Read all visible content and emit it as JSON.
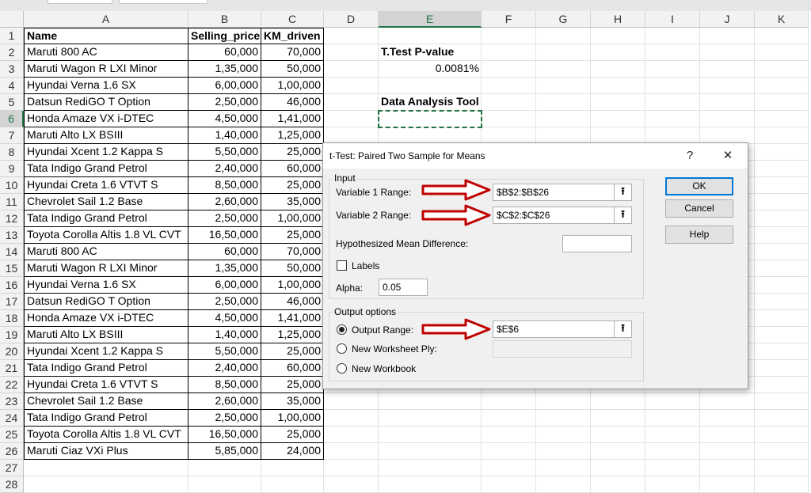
{
  "columns": [
    "A",
    "B",
    "C",
    "D",
    "E",
    "F",
    "G",
    "H",
    "I",
    "J",
    "K"
  ],
  "rows": [
    "1",
    "2",
    "3",
    "4",
    "5",
    "6",
    "7",
    "8",
    "9",
    "10",
    "11",
    "12",
    "13",
    "14",
    "15",
    "16",
    "17",
    "18",
    "19",
    "20",
    "21",
    "22",
    "23",
    "24",
    "25",
    "26",
    "27",
    "28"
  ],
  "table": {
    "headers": [
      "Name",
      "Selling_price",
      "KM_driven"
    ],
    "data": [
      [
        "Maruti 800 AC",
        "60,000",
        "70,000"
      ],
      [
        "Maruti Wagon R LXI Minor",
        "1,35,000",
        "50,000"
      ],
      [
        "Hyundai Verna 1.6 SX",
        "6,00,000",
        "1,00,000"
      ],
      [
        "Datsun RediGO T Option",
        "2,50,000",
        "46,000"
      ],
      [
        "Honda Amaze VX i-DTEC",
        "4,50,000",
        "1,41,000"
      ],
      [
        "Maruti Alto LX BSIII",
        "1,40,000",
        "1,25,000"
      ],
      [
        "Hyundai Xcent 1.2 Kappa S",
        "5,50,000",
        "25,000"
      ],
      [
        "Tata Indigo Grand Petrol",
        "2,40,000",
        "60,000"
      ],
      [
        "Hyundai Creta 1.6 VTVT S",
        "8,50,000",
        "25,000"
      ],
      [
        "Chevrolet Sail 1.2 Base",
        "2,60,000",
        "35,000"
      ],
      [
        "Tata Indigo Grand Petrol",
        "2,50,000",
        "1,00,000"
      ],
      [
        "Toyota Corolla Altis 1.8 VL CVT",
        "16,50,000",
        "25,000"
      ],
      [
        "Maruti 800 AC",
        "60,000",
        "70,000"
      ],
      [
        "Maruti Wagon R LXI Minor",
        "1,35,000",
        "50,000"
      ],
      [
        "Hyundai Verna 1.6 SX",
        "6,00,000",
        "1,00,000"
      ],
      [
        "Datsun RediGO T Option",
        "2,50,000",
        "46,000"
      ],
      [
        "Honda Amaze VX i-DTEC",
        "4,50,000",
        "1,41,000"
      ],
      [
        "Maruti Alto LX BSIII",
        "1,40,000",
        "1,25,000"
      ],
      [
        "Hyundai Xcent 1.2 Kappa S",
        "5,50,000",
        "25,000"
      ],
      [
        "Tata Indigo Grand Petrol",
        "2,40,000",
        "60,000"
      ],
      [
        "Hyundai Creta 1.6 VTVT S",
        "8,50,000",
        "25,000"
      ],
      [
        "Chevrolet Sail 1.2 Base",
        "2,60,000",
        "35,000"
      ],
      [
        "Tata Indigo Grand Petrol",
        "2,50,000",
        "1,00,000"
      ],
      [
        "Toyota Corolla Altis 1.8 VL CVT",
        "16,50,000",
        "25,000"
      ],
      [
        "Maruti Ciaz VXi Plus",
        "5,85,000",
        "24,000"
      ]
    ]
  },
  "side_cells": {
    "ttest_label": "T.Test P-value",
    "ttest_value": "0.0081%",
    "tool_label": "Data Analysis Tool"
  },
  "selected": {
    "column": "E",
    "row": "6"
  },
  "dialog": {
    "title": "t-Test: Paired Two Sample for Means",
    "help_glyph": "?",
    "close_glyph": "✕",
    "input_group": "Input",
    "var1_label": "Variable 1 Range:",
    "var1_value": "$B$2:$B$26",
    "var2_label": "Variable 2 Range:",
    "var2_value": "$C$2:$C$26",
    "hyp_label": "Hypothesized Mean Difference:",
    "hyp_value": "",
    "labels_label": "Labels",
    "labels_checked": false,
    "alpha_label": "Alpha:",
    "alpha_value": "0.05",
    "output_group": "Output options",
    "output_range_label": "Output Range:",
    "output_range_value": "$E$6",
    "new_ply_label": "New Worksheet Ply:",
    "new_workbook_label": "New Workbook",
    "ok_label": "OK",
    "cancel_label": "Cancel",
    "help_label": "Help",
    "collapse_glyph": "⭱"
  },
  "colors": {
    "accent": "#217346",
    "arrow": "#c00000",
    "default_button": "#0078d7"
  }
}
